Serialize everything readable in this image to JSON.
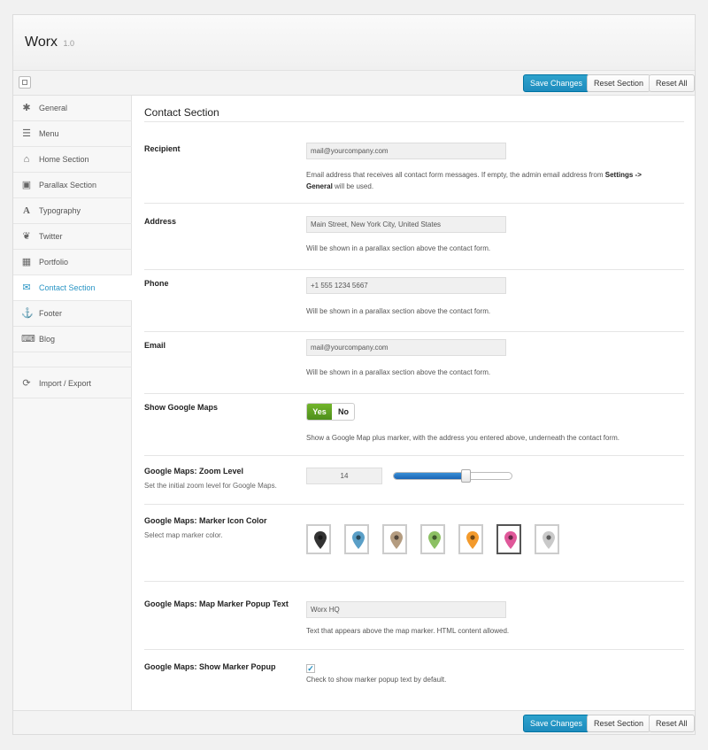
{
  "header": {
    "title": "Worx",
    "version": "1.0"
  },
  "toolbar": {
    "save_label": "Save Changes",
    "reset_section_label": "Reset Section",
    "reset_all_label": "Reset All"
  },
  "sidebar": {
    "items": [
      {
        "label": "General",
        "icon": "gear-icon"
      },
      {
        "label": "Menu",
        "icon": "menu-icon"
      },
      {
        "label": "Home Section",
        "icon": "home-icon"
      },
      {
        "label": "Parallax Section",
        "icon": "image-icon"
      },
      {
        "label": "Typography",
        "icon": "font-icon"
      },
      {
        "label": "Twitter",
        "icon": "twitter-icon"
      },
      {
        "label": "Portfolio",
        "icon": "grid-icon"
      },
      {
        "label": "Contact Section",
        "icon": "envelope-icon"
      },
      {
        "label": "Footer",
        "icon": "anchor-icon"
      },
      {
        "label": "Blog",
        "icon": "keyboard-icon"
      },
      {
        "label": "Import / Export",
        "icon": "refresh-icon"
      }
    ],
    "active": "Contact Section"
  },
  "main": {
    "section_title": "Contact Section",
    "recipient": {
      "label": "Recipient",
      "value": "mail@yourcompany.com",
      "desc_prefix": "Email address that receives all contact form messages. If empty, the admin email address from ",
      "desc_bold_1": "Settings ->",
      "desc_bold_2": "General",
      "desc_suffix": " will be used."
    },
    "address": {
      "label": "Address",
      "value": "Main Street, New York City, United States",
      "desc": "Will be shown in a parallax section above the contact form."
    },
    "phone": {
      "label": "Phone",
      "value": "+1 555 1234 5667",
      "desc": "Will be shown in a parallax section above the contact form."
    },
    "email": {
      "label": "Email",
      "value": "mail@yourcompany.com",
      "desc": "Will be shown in a parallax section above the contact form."
    },
    "show_maps": {
      "label": "Show Google Maps",
      "yes": "Yes",
      "no": "No",
      "selected": "Yes",
      "desc": "Show a Google Map plus marker, with the address you entered above, underneath the contact form."
    },
    "zoom": {
      "label": "Google Maps: Zoom Level",
      "sub": "Set the initial zoom level for Google Maps.",
      "value": "14",
      "fraction": 0.61
    },
    "marker_color": {
      "label": "Google Maps: Marker Icon Color",
      "sub": "Select map marker color.",
      "colors": [
        "#333333",
        "#5a9fc7",
        "#b49c80",
        "#8cc063",
        "#f39a2c",
        "#e0589a",
        "#c9c9c9"
      ],
      "selected_index": 5
    },
    "popup_text": {
      "label": "Google Maps: Map Marker Popup Text",
      "value": "Worx HQ",
      "desc": "Text that appears above the map marker. HTML content allowed."
    },
    "show_popup": {
      "label": "Google Maps: Show Marker Popup",
      "checked": "✓",
      "desc": "Check to show marker popup text by default."
    }
  }
}
